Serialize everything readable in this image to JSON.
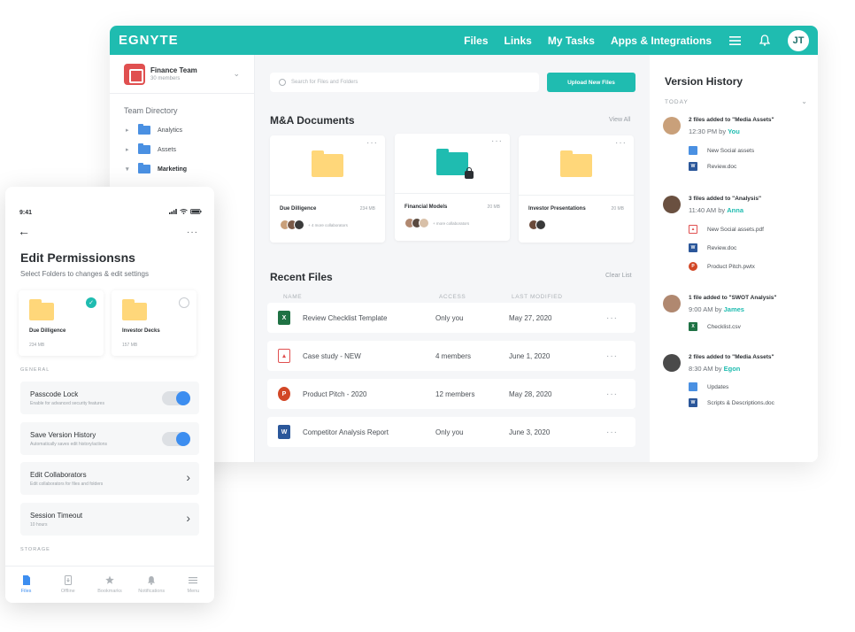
{
  "topbar": {
    "logo": "EGNYTE",
    "nav": [
      "Files",
      "Links",
      "My Tasks",
      "Apps & Integrations"
    ],
    "user_initials": "JT",
    "brand_color": "#1fbcb0"
  },
  "sidebar": {
    "team_name": "Finance Team",
    "team_members": "30 members",
    "directory_title": "Team Directory",
    "items": [
      {
        "label": "Analytics"
      },
      {
        "label": "Assets"
      },
      {
        "label": "Marketing"
      }
    ]
  },
  "main": {
    "search_placeholder": "Search for Files and Folders",
    "upload_label": "Upload New Files",
    "ma_title": "M&A Documents",
    "view_all": "View All",
    "cards": [
      {
        "name": "Due Dilligence",
        "size": "234 MB",
        "collab": "+ 4 more collaborators"
      },
      {
        "name": "Financial Models",
        "size": "20 MB",
        "collab": "+ more collaborators"
      },
      {
        "name": "Investor Presentations",
        "size": "20 MB",
        "collab": ""
      }
    ],
    "recent_title": "Recent Files",
    "clear_list": "Clear List",
    "columns": [
      "NAME",
      "ACCESS",
      "LAST MODIFIED"
    ],
    "rows": [
      {
        "name": "Review Checklist Template",
        "access": "Only you",
        "modified": "May 27, 2020",
        "type": "xls"
      },
      {
        "name": "Case study - NEW",
        "access": "4 members",
        "modified": "June 1, 2020",
        "type": "pdf"
      },
      {
        "name": "Product Pitch - 2020",
        "access": "12 members",
        "modified": "May 28, 2020",
        "type": "ppt"
      },
      {
        "name": "Competitor Analysis Report",
        "access": "Only you",
        "modified": "June 3, 2020",
        "type": "doc"
      }
    ]
  },
  "history": {
    "title": "Version History",
    "today": "TODAY",
    "groups": [
      {
        "head": "2 files added to \"Media Assets\"",
        "time": "12:30 PM by",
        "who": "You",
        "files": [
          "New Social assets",
          "Review.doc"
        ]
      },
      {
        "head": "3 files added to \"Analysis\"",
        "time": "11:40 AM by",
        "who": "Anna",
        "files": [
          "New Social assets.pdf",
          "Review.doc",
          "Product Pitch.pwtx"
        ]
      },
      {
        "head": "1 file added to \"SWOT Analysis\"",
        "time": "9:00 AM by",
        "who": "James",
        "files": [
          "Checklist.csv"
        ]
      },
      {
        "head": "2 files added to \"Media Assets\"",
        "time": "8:30 AM by",
        "who": "Egon",
        "files": [
          "Updates",
          "Scripts & Descriptions.doc"
        ]
      }
    ]
  },
  "mobile": {
    "time": "9:41",
    "title": "Edit Permissionsns",
    "subtitle": "Select Folders to changes & edit settings",
    "folders": [
      {
        "name": "Due Dilligence",
        "size": "234 MB",
        "checked": true
      },
      {
        "name": "Investor Decks",
        "size": "157 MB",
        "checked": false
      }
    ],
    "general_label": "GENERAL",
    "settings": [
      {
        "title": "Passcode Lock",
        "sub": "Enable for advanced security features"
      },
      {
        "title": "Save Version History",
        "sub": "Automatically saves edit history/actions"
      },
      {
        "title": "Edit Collaborators",
        "sub": "Edit collaborators for files and folders"
      },
      {
        "title": "Session Timeout",
        "sub": "10 hours"
      }
    ],
    "storage_label": "STORAGE",
    "tabs": [
      "Files",
      "Offline",
      "Bookmarks",
      "Notifications",
      "Menu"
    ]
  }
}
